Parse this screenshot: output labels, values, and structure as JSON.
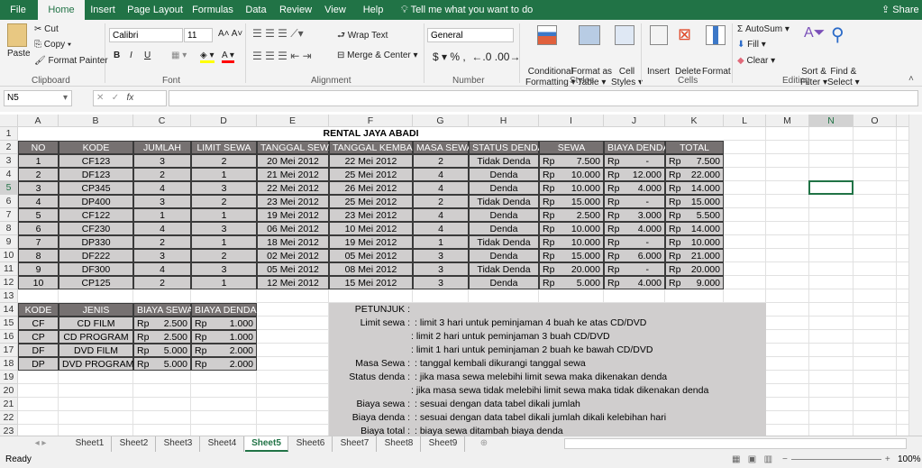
{
  "ribbon_tabs": [
    "File",
    "Home",
    "Insert",
    "Page Layout",
    "Formulas",
    "Data",
    "Review",
    "View",
    "Help"
  ],
  "active_tab": "Home",
  "tell_me": "Tell me what you want to do",
  "share": "Share",
  "clipboard": {
    "paste": "Paste",
    "cut": "Cut",
    "copy": "Copy",
    "format_painter": "Format Painter",
    "group": "Clipboard"
  },
  "font": {
    "name": "Calibri",
    "size": "11",
    "bold": "B",
    "italic": "I",
    "underline": "U",
    "group": "Font",
    "fill_color": "#ffff00",
    "font_color": "#ff0000"
  },
  "alignment": {
    "wrap": "Wrap Text",
    "merge": "Merge & Center",
    "group": "Alignment"
  },
  "number": {
    "format": "General",
    "currency": "$",
    "percent": "%",
    "comma": ",",
    "group": "Number"
  },
  "styles": {
    "conditional": [
      "Conditional",
      "Formatting"
    ],
    "format_table": [
      "Format as",
      "Table"
    ],
    "cell_styles": [
      "Cell",
      "Styles"
    ],
    "group": "Styles"
  },
  "cells": {
    "insert": "Insert",
    "delete": "Delete",
    "format": "Format",
    "group": "Cells"
  },
  "editing": {
    "autosum": "AutoSum",
    "fill": "Fill",
    "clear": "Clear",
    "sort": [
      "Sort &",
      "Filter"
    ],
    "find": [
      "Find &",
      "Select"
    ],
    "group": "Editing"
  },
  "name_box": "N5",
  "formula_value": "",
  "columns": [
    "A",
    "B",
    "C",
    "D",
    "E",
    "F",
    "G",
    "H",
    "I",
    "J",
    "K",
    "L",
    "M",
    "N",
    "O"
  ],
  "rows": [
    "1",
    "2",
    "3",
    "4",
    "5",
    "6",
    "7",
    "8",
    "9",
    "10",
    "11",
    "12",
    "13",
    "14",
    "15",
    "16",
    "17",
    "18",
    "19",
    "20",
    "21",
    "22",
    "23"
  ],
  "selected_cell": "N5",
  "title": "RENTAL JAYA ABADI",
  "main_table": {
    "headers": [
      "NO",
      "KODE",
      "JUMLAH",
      "LIMIT SEWA",
      "TANGGAL SEWA",
      "TANGGAL KEMBALI",
      "MASA SEWA",
      "STATUS DENDA",
      "SEWA",
      "BIAYA DENDA",
      "TOTAL"
    ],
    "currency": "Rp",
    "rows": [
      [
        "1",
        "CF123",
        "3",
        "2",
        "20 Mei 2012",
        "22 Mei 2012",
        "2",
        "Tidak Denda",
        "7.500",
        "-",
        "7.500"
      ],
      [
        "2",
        "DF123",
        "2",
        "1",
        "21 Mei 2012",
        "25 Mei 2012",
        "4",
        "Denda",
        "10.000",
        "12.000",
        "22.000"
      ],
      [
        "3",
        "CP345",
        "4",
        "3",
        "22 Mei 2012",
        "26 Mei 2012",
        "4",
        "Denda",
        "10.000",
        "4.000",
        "14.000"
      ],
      [
        "4",
        "DP400",
        "3",
        "2",
        "23 Mei 2012",
        "25 Mei 2012",
        "2",
        "Tidak Denda",
        "15.000",
        "-",
        "15.000"
      ],
      [
        "5",
        "CF122",
        "1",
        "1",
        "19 Mei 2012",
        "23 Mei 2012",
        "4",
        "Denda",
        "2.500",
        "3.000",
        "5.500"
      ],
      [
        "6",
        "CF230",
        "4",
        "3",
        "06 Mei 2012",
        "10 Mei 2012",
        "4",
        "Denda",
        "10.000",
        "4.000",
        "14.000"
      ],
      [
        "7",
        "DP330",
        "2",
        "1",
        "18 Mei 2012",
        "19 Mei 2012",
        "1",
        "Tidak Denda",
        "10.000",
        "-",
        "10.000"
      ],
      [
        "8",
        "DF222",
        "3",
        "2",
        "02 Mei 2012",
        "05 Mei 2012",
        "3",
        "Denda",
        "15.000",
        "6.000",
        "21.000"
      ],
      [
        "9",
        "DF300",
        "4",
        "3",
        "05 Mei 2012",
        "08 Mei 2012",
        "3",
        "Tidak Denda",
        "20.000",
        "-",
        "20.000"
      ],
      [
        "10",
        "CP125",
        "2",
        "1",
        "12 Mei 2012",
        "15 Mei 2012",
        "3",
        "Denda",
        "5.000",
        "4.000",
        "9.000"
      ]
    ]
  },
  "ref_table": {
    "headers": [
      "KODE",
      "JENIS",
      "BIAYA SEWA",
      "BIAYA DENDA"
    ],
    "rows": [
      [
        "CF",
        "CD FILM",
        "2.500",
        "1.000"
      ],
      [
        "CP",
        "CD PROGRAM",
        "2.500",
        "1.000"
      ],
      [
        "DF",
        "DVD FILM",
        "5.000",
        "2.000"
      ],
      [
        "DP",
        "DVD PROGRAM",
        "5.000",
        "2.000"
      ]
    ]
  },
  "petunjuk": {
    "title": "PETUNJUK :",
    "lines": [
      [
        "Limit sewa :",
        "limit 3 hari untuk peminjaman 4 buah ke atas CD/DVD"
      ],
      [
        "",
        ": limit 2 hari untuk peminjaman 3 buah CD/DVD"
      ],
      [
        "",
        ": limit 1 hari untuk peminjaman 2 buah ke bawah CD/DVD"
      ],
      [
        "Masa Sewa :",
        "tanggal kembali dikurangi tanggal sewa"
      ],
      [
        "Status denda :",
        "jika masa sewa melebihi limit sewa maka dikenakan denda"
      ],
      [
        "",
        ": jika masa sewa tidak melebihi limit sewa maka tidak dikenakan denda"
      ],
      [
        "Biaya sewa :",
        "sesuai dengan data tabel dikali jumlah"
      ],
      [
        "Biaya denda :",
        "sesuai dengan data tabel dikali jumlah dikali kelebihan hari"
      ],
      [
        "Biaya total :",
        "biaya sewa ditambah biaya denda"
      ]
    ]
  },
  "sheets": [
    "Sheet1",
    "Sheet2",
    "Sheet3",
    "Sheet4",
    "Sheet5",
    "Sheet6",
    "Sheet7",
    "Sheet8",
    "Sheet9"
  ],
  "active_sheet": "Sheet5",
  "status": "Ready",
  "zoom": "100%",
  "colors": {
    "brand": "#217346",
    "header_fill": "#767171",
    "cell_fill": "#d0cece"
  }
}
